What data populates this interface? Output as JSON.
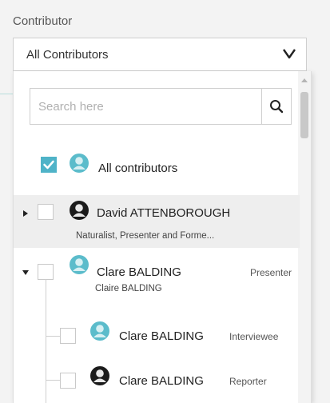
{
  "filter": {
    "label": "Contributor",
    "selected": "All Contributors"
  },
  "search": {
    "placeholder": "Search here",
    "value": ""
  },
  "items": {
    "all": {
      "label": "All contributors",
      "checked": true
    },
    "attenborough": {
      "name": "David ATTENBOROUGH",
      "subtitle": "Naturalist, Presenter and Forme...",
      "expanded": false,
      "checked": false,
      "avatar": "person-dark-icon"
    },
    "balding": {
      "name": "Clare BALDING",
      "role": "Presenter",
      "subtitle": "Claire BALDING",
      "expanded": true,
      "checked": false,
      "avatar": "person-teal-icon",
      "children": [
        {
          "name": "Clare BALDING",
          "role": "Interviewee",
          "checked": false,
          "avatar": "person-teal-icon"
        },
        {
          "name": "Clare BALDING",
          "role": "Reporter",
          "checked": false,
          "avatar": "person-dark-icon"
        }
      ]
    }
  },
  "colors": {
    "accent": "#4fb3c8",
    "avatar_teal": "#5bbccb",
    "avatar_dark": "#1b1b1b",
    "row_highlight": "#eeeeee"
  }
}
